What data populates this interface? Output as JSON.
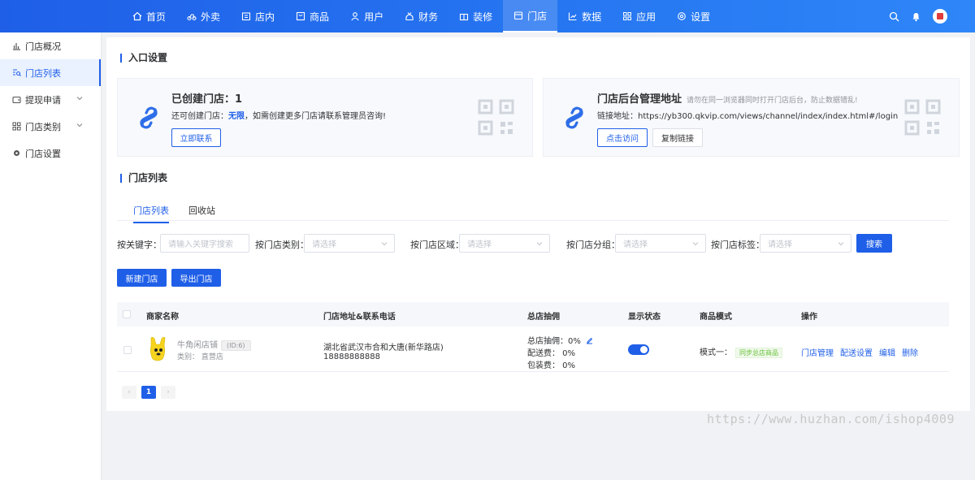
{
  "topnav": {
    "items": [
      {
        "label": "首页",
        "icon": "home-icon"
      },
      {
        "label": "外卖",
        "icon": "bike-icon"
      },
      {
        "label": "店内",
        "icon": "store-icon"
      },
      {
        "label": "商品",
        "icon": "goods-icon"
      },
      {
        "label": "用户",
        "icon": "user-icon"
      },
      {
        "label": "财务",
        "icon": "finance-icon"
      },
      {
        "label": "装修",
        "icon": "decor-icon"
      },
      {
        "label": "门店",
        "icon": "shop-icon"
      },
      {
        "label": "数据",
        "icon": "chart-icon"
      },
      {
        "label": "应用",
        "icon": "apps-icon"
      },
      {
        "label": "设置",
        "icon": "gear-icon"
      }
    ],
    "active_index": 7
  },
  "sidebar": {
    "items": [
      {
        "label": "门店概况"
      },
      {
        "label": "门店列表"
      },
      {
        "label": "提现申请"
      },
      {
        "label": "门店类别"
      },
      {
        "label": "门店设置"
      }
    ]
  },
  "entry": {
    "title": "入口设置",
    "card1": {
      "title": "已创建门店：1",
      "desc_prefix": "还可创建门店：",
      "desc_highlight": "无限",
      "desc_suffix": "，如需创建更多门店请联系管理员咨询!",
      "button": "立即联系"
    },
    "card2": {
      "title": "门店后台管理地址",
      "note": "请勿在同一浏览器同时打开门店后台，防止数据错乱!",
      "desc": "链接地址：https://yb300.qkvip.com/views/channel/index/index.html#/login",
      "button_visit": "点击访问",
      "button_copy": "复制链接"
    }
  },
  "list": {
    "title": "门店列表",
    "tabs": [
      "门店列表",
      "回收站"
    ],
    "filters": {
      "keyword_label": "按关键字：",
      "keyword_placeholder": "请输入关键字搜索",
      "type_label": "按门店类别：",
      "area_label": "按门店区域：",
      "group_label": "按门店分组：",
      "tag_label": "按门店标签：",
      "select_placeholder": "请选择",
      "search_button": "搜索"
    },
    "actions": {
      "new": "新建门店",
      "export": "导出门店"
    },
    "columns": [
      "商家名称",
      "门店地址&联系电话",
      "总店抽佣",
      "显示状态",
      "商品模式",
      "操作"
    ],
    "rows": [
      {
        "name": "牛角闲店铺",
        "id": "(ID:6)",
        "type": "类别：  直营店",
        "address": "湖北省武汉市合和大唐(新华路店)",
        "phone": "18888888888",
        "commission": "总店抽佣：0%",
        "delivery_fee": "配送费：   0%",
        "packing_fee": "包装费：   0%",
        "mode": "模式一：",
        "mode_tag": "同步总店商品",
        "ops": [
          "门店管理",
          "配送设置",
          "编辑",
          "删除"
        ]
      }
    ],
    "pagination": {
      "prev": "‹",
      "page": "1",
      "next": "›"
    }
  },
  "watermark": "https://www.huzhan.com/ishop4009",
  "colors": {
    "primary": "#1f5fe8",
    "success": "#67c23a"
  }
}
